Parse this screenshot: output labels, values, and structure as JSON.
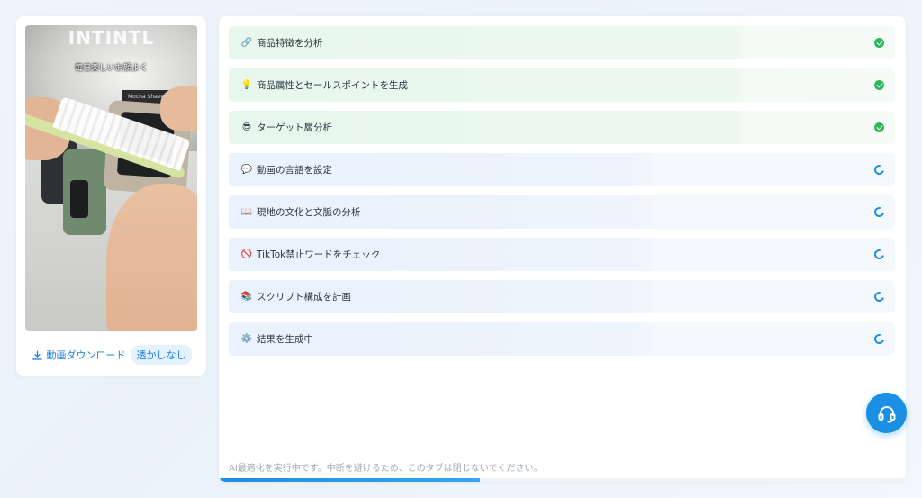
{
  "video": {
    "overlay_top_text": "INTINTL",
    "caption": "毎日楽しいお顔よく",
    "product_label": "Mocha Shaver"
  },
  "download": {
    "label": "動画ダウンロード",
    "badge": "透かしなし",
    "icon": "download-icon"
  },
  "steps": [
    {
      "emoji": "🔗",
      "label": "商品特徴を分析",
      "status": "done"
    },
    {
      "emoji": "💡",
      "label": "商品属性とセールスポイントを生成",
      "status": "done"
    },
    {
      "emoji": "😎",
      "label": "ターゲット層分析",
      "status": "done"
    },
    {
      "emoji": "💬",
      "label": "動画の言語を設定",
      "status": "loading"
    },
    {
      "emoji": "📖",
      "label": "現地の文化と文脈の分析",
      "status": "loading"
    },
    {
      "emoji": "🚫",
      "label": "TikTok禁止ワードをチェック",
      "status": "loading"
    },
    {
      "emoji": "📚",
      "label": "スクリプト構成を計画",
      "status": "loading"
    },
    {
      "emoji": "⚙️",
      "label": "結果を生成中",
      "status": "loading"
    }
  ],
  "footer_note": "AI最適化を実行中です。中断を避けるため、このタブは閉じないでください。",
  "progress": 0.38,
  "support_button": {
    "icon": "headset-icon"
  },
  "colors": {
    "accent": "#1a8fe3",
    "done_green": "#2fb65c",
    "done_row_bg": "#e8f7ee",
    "pending_row_bg": "#e9f2fd"
  }
}
